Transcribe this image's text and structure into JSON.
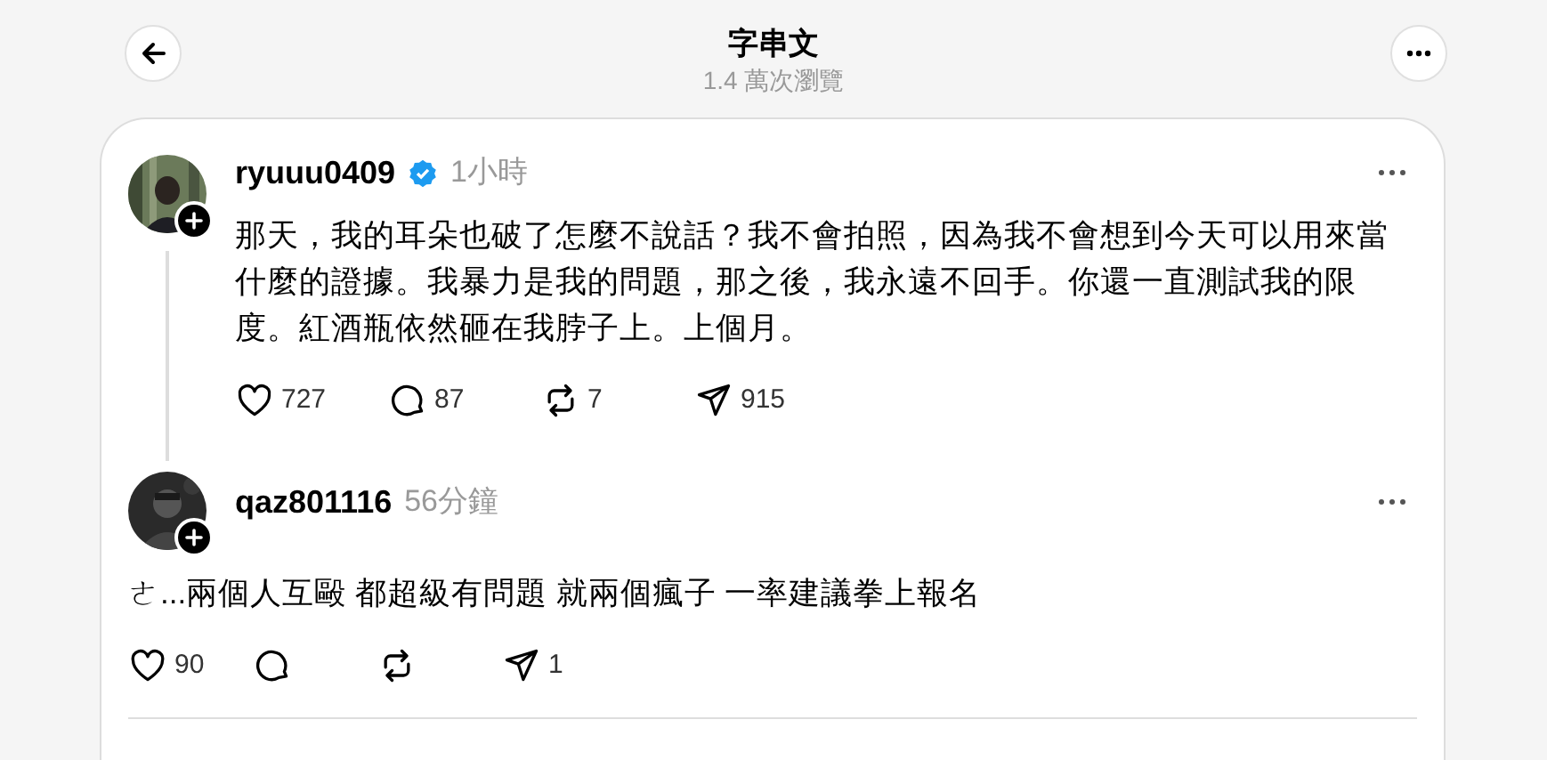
{
  "header": {
    "title": "字串文",
    "subtitle": "1.4 萬次瀏覽"
  },
  "posts": [
    {
      "username": "ryuuu0409",
      "verified": true,
      "time": "1小時",
      "text": "那天，我的耳朵也破了怎麼不說話？我不會拍照，因為我不會想到今天可以用來當什麼的證據。我暴力是我的問題，那之後，我永遠不回手。你還一直測試我的限度。紅酒瓶依然砸在我脖子上。上個月。",
      "thread_line": true,
      "likes": "727",
      "replies": "87",
      "reposts": "7",
      "shares": "915"
    },
    {
      "username": "qaz801116",
      "verified": false,
      "time": "56分鐘",
      "text": "ㄜ...兩個人互毆 都超級有問題 就兩個瘋子 一率建議拳上報名",
      "thread_line": false,
      "likes": "90",
      "shares": "1"
    }
  ]
}
